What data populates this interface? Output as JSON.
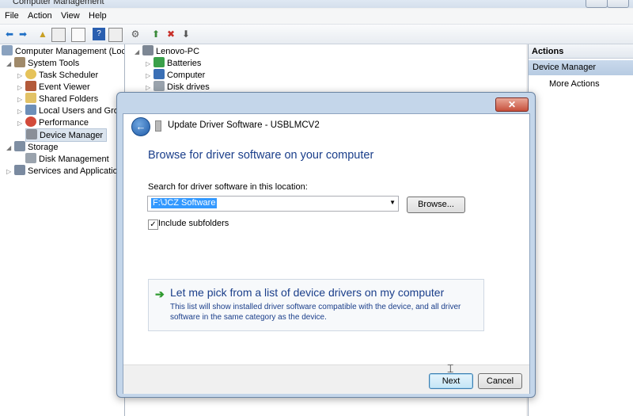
{
  "window": {
    "title": "Computer Management"
  },
  "menu": {
    "items": [
      "File",
      "Action",
      "View",
      "Help"
    ]
  },
  "toolbar": {
    "icons": [
      "back-arrow-icon",
      "forward-arrow-icon",
      "up-folder-icon",
      "show-hide-tree-icon",
      "properties-icon",
      "help-icon",
      "show-hide-action-pane-icon",
      "scan-hardware-icon",
      "update-driver-icon",
      "uninstall-icon",
      "disable-device-icon"
    ]
  },
  "tree": {
    "items": [
      {
        "label": "Computer Management (Local",
        "icon": "computer-management-icon"
      },
      {
        "label": "System Tools",
        "icon": "system-tools-icon"
      },
      {
        "label": "Task Scheduler",
        "icon": "clock-icon"
      },
      {
        "label": "Event Viewer",
        "icon": "event-viewer-icon"
      },
      {
        "label": "Shared Folders",
        "icon": "shared-folder-icon"
      },
      {
        "label": "Local Users and Group",
        "icon": "users-icon"
      },
      {
        "label": "Performance",
        "icon": "performance-icon"
      },
      {
        "label": "Device Manager",
        "icon": "device-manager-icon"
      },
      {
        "label": "Storage",
        "icon": "storage-icon"
      },
      {
        "label": "Disk Management",
        "icon": "disk-icon"
      },
      {
        "label": "Services and Applications",
        "icon": "services-icon"
      }
    ]
  },
  "devices": {
    "items": [
      {
        "label": "Lenovo-PC",
        "icon": "pc-icon"
      },
      {
        "label": "Batteries",
        "icon": "battery-icon"
      },
      {
        "label": "Computer",
        "icon": "computer-icon"
      },
      {
        "label": "Disk drives",
        "icon": "disk-drive-icon"
      }
    ]
  },
  "actions": {
    "header": "Actions",
    "section": "Device Manager",
    "more": "More Actions"
  },
  "dialog": {
    "title": "Update Driver Software - USBLMCV2",
    "heading": "Browse for driver software on your computer",
    "search_label": "Search for driver software in this location:",
    "path_value": "F:\\JCZ Software",
    "browse_label": "Browse...",
    "include_subfolders_label": "Include subfolders",
    "include_subfolders_checked": true,
    "pick_title": "Let me pick from a list of device drivers on my computer",
    "pick_desc": "This list will show installed driver software compatible with the device, and all driver software in the same category as the device.",
    "next_label": "Next",
    "cancel_label": "Cancel"
  },
  "colors": {
    "heading_blue": "#1a3e8a",
    "selection_blue": "#3399ff",
    "arrow_green": "#2f9a2f"
  }
}
